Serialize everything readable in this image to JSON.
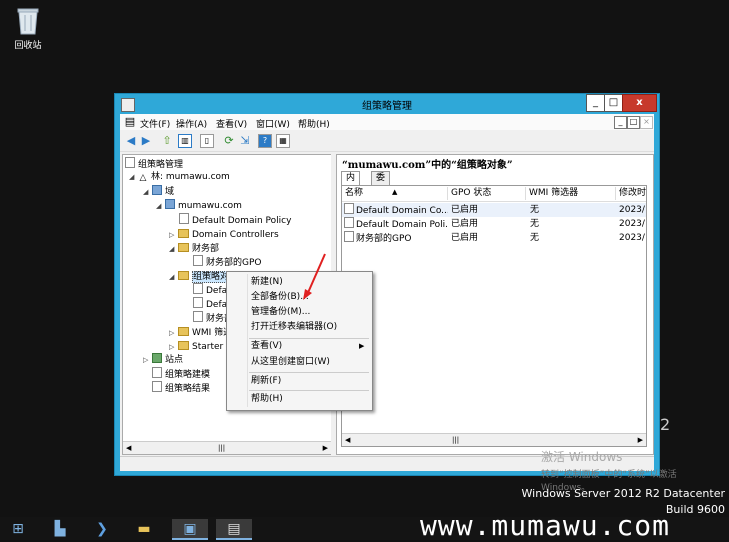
{
  "desktop": {
    "recycle_bin_label": "回收站"
  },
  "window": {
    "title": "组策略管理",
    "buttons": {
      "minimize": "_",
      "maximize": "□",
      "close": "x"
    },
    "menus": [
      "文件(F)",
      "操作(A)",
      "查看(V)",
      "窗口(W)",
      "帮助(H)"
    ],
    "mdi_buttons": [
      "_",
      "□",
      "×"
    ]
  },
  "tree": {
    "root": "组策略管理",
    "forest": "林: mumawu.com",
    "domains": "域",
    "domain": "mumawu.com",
    "default_policy": "Default Domain Policy",
    "domain_controllers": "Domain Controllers",
    "ou_finance": "财务部",
    "finance_gpo": "财务部的GPO",
    "gpo_objects": "组策略对象",
    "gpo_child_1": "Defa",
    "gpo_child_2": "Defa",
    "gpo_child_3": "财务部",
    "wmi_filters": "WMI 筛选",
    "starter_gpos": "Starter G",
    "sites": "站点",
    "modeling": "组策略建模",
    "results": "组策略结果",
    "scroll_thumb": "|||"
  },
  "details": {
    "heading": "“mumawu.com”中的“组策略对象”",
    "tabs": [
      "内容",
      "委派"
    ],
    "columns": [
      "名称",
      "GPO 状态",
      "WMI 筛选器",
      "修改时"
    ],
    "rows": [
      {
        "name": "Default Domain Co...",
        "status": "已启用",
        "wmi": "无",
        "modified": "2023/"
      },
      {
        "name": "Default Domain Poli...",
        "status": "已启用",
        "wmi": "无",
        "modified": "2023/"
      },
      {
        "name": "财务部的GPO",
        "status": "已启用",
        "wmi": "无",
        "modified": "2023/"
      }
    ],
    "scroll_thumb": "|||"
  },
  "context_menu": {
    "items": [
      "新建(N)",
      "全部备份(B)...",
      "管理备份(M)...",
      "打开迁移表编辑器(O)",
      "查看(V)",
      "从这里创建窗口(W)",
      "刷新(F)",
      "帮助(H)"
    ],
    "submenu_arrow": "▶"
  },
  "activation": {
    "line1": "激活 Windows",
    "line2": "转到“控制面板”中的“系统”以激活",
    "line3": "Windows。"
  },
  "edition": {
    "line1": "Windows Server 2012 R2 Datacenter",
    "line2": "Build 9600"
  },
  "fragment": "2",
  "brand": "www.mumawu.com",
  "colors": {
    "window_frame": "#2fa8d8",
    "close_button": "#c7392c",
    "selection": "#cce8ff",
    "desktop": "#121212"
  }
}
